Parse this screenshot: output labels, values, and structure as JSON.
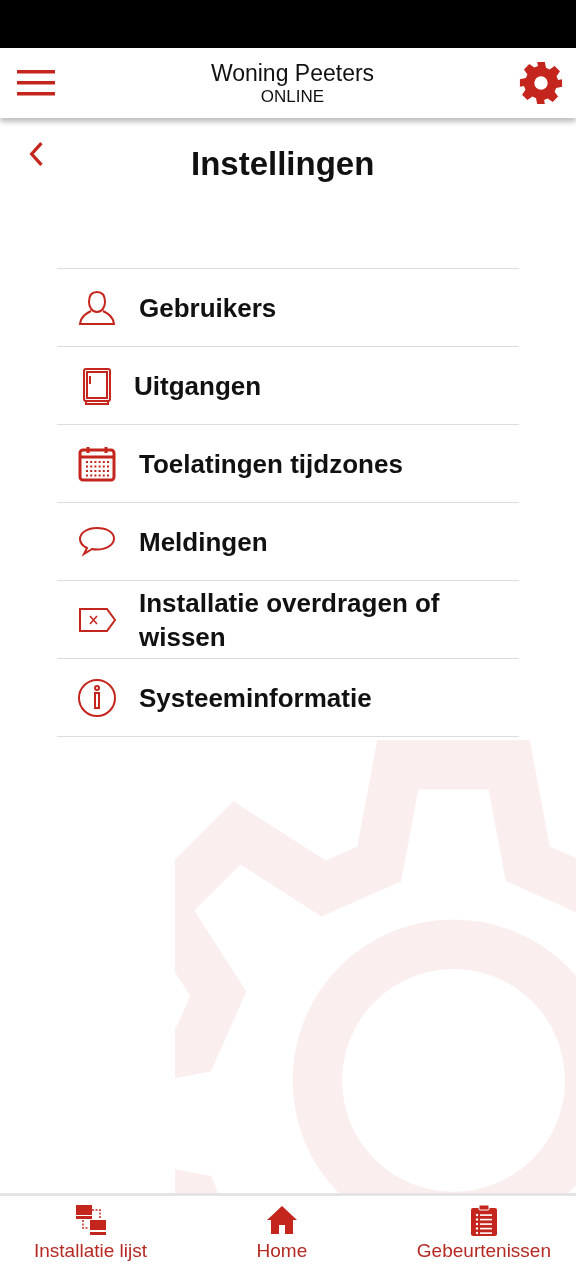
{
  "header": {
    "title": "Woning Peeters",
    "status": "ONLINE"
  },
  "page": {
    "title": "Instellingen"
  },
  "items": [
    {
      "kind": "user",
      "label": "Gebruikers"
    },
    {
      "kind": "door",
      "label": "Uitgangen"
    },
    {
      "kind": "calendar",
      "label": "Toelatingen tijdzones"
    },
    {
      "kind": "message",
      "label": "Meldingen"
    },
    {
      "kind": "tag",
      "label": "Installatie overdragen of wissen"
    },
    {
      "kind": "info",
      "label": "Systeeminformatie"
    }
  ],
  "nav": [
    {
      "kind": "list",
      "label": "Installatie lijst"
    },
    {
      "kind": "home",
      "label": "Home"
    },
    {
      "kind": "clipboard",
      "label": "Gebeurtenissen"
    }
  ]
}
